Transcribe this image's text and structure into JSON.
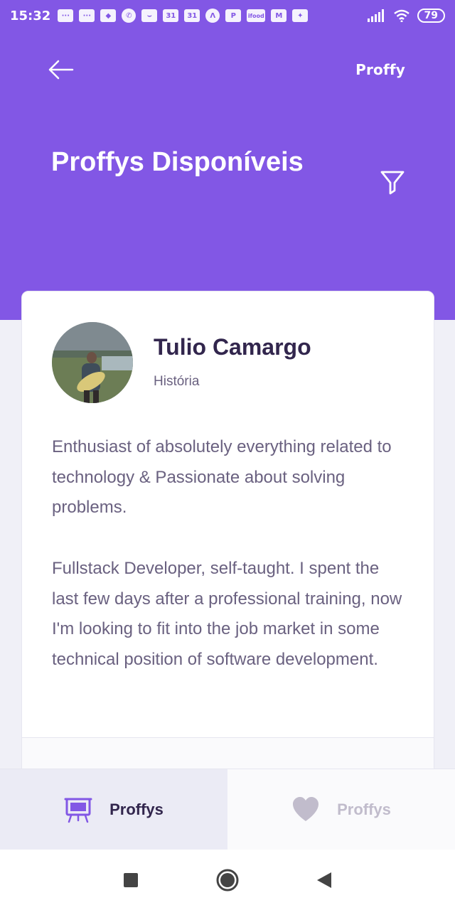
{
  "status_bar": {
    "time": "15:32",
    "notifications": [
      {
        "icon": "chat-icon",
        "label": "···"
      },
      {
        "icon": "chat-icon",
        "label": "···"
      },
      {
        "icon": "discord-icon",
        "label": "◆"
      },
      {
        "icon": "whatsapp-icon",
        "label": "✆"
      },
      {
        "icon": "app-icon",
        "label": "⌣"
      },
      {
        "icon": "calendar-icon",
        "label": "31"
      },
      {
        "icon": "calendar-icon",
        "label": "31"
      },
      {
        "icon": "app-icon",
        "label": "Λ"
      },
      {
        "icon": "app-icon",
        "label": "P"
      },
      {
        "icon": "ifood-icon",
        "label": "ifood"
      },
      {
        "icon": "gmail-icon",
        "label": "M"
      },
      {
        "icon": "app-icon",
        "label": "✦"
      }
    ],
    "battery": "79"
  },
  "header": {
    "brand": "Proffy",
    "title": "Proffys Disponíveis"
  },
  "teacher": {
    "name": "Tulio Camargo",
    "subject": "História",
    "bio_paragraphs": [
      "Enthusiast of absolutely everything related to technology & Passionate about solving problems.",
      "Fullstack Developer, self-taught. I spent the last few days after a professional training, now I'm looking to fit into the job market in some technical position of software development."
    ]
  },
  "tabs": [
    {
      "label": "Proffys",
      "icon": "easel-icon",
      "active": true
    },
    {
      "label": "Proffys",
      "icon": "heart-icon",
      "active": false
    }
  ],
  "colors": {
    "primary": "#8257e5",
    "title": "#32264d",
    "text": "#6a6180",
    "inactive": "#c1bccc",
    "background": "#f0f0f7"
  }
}
